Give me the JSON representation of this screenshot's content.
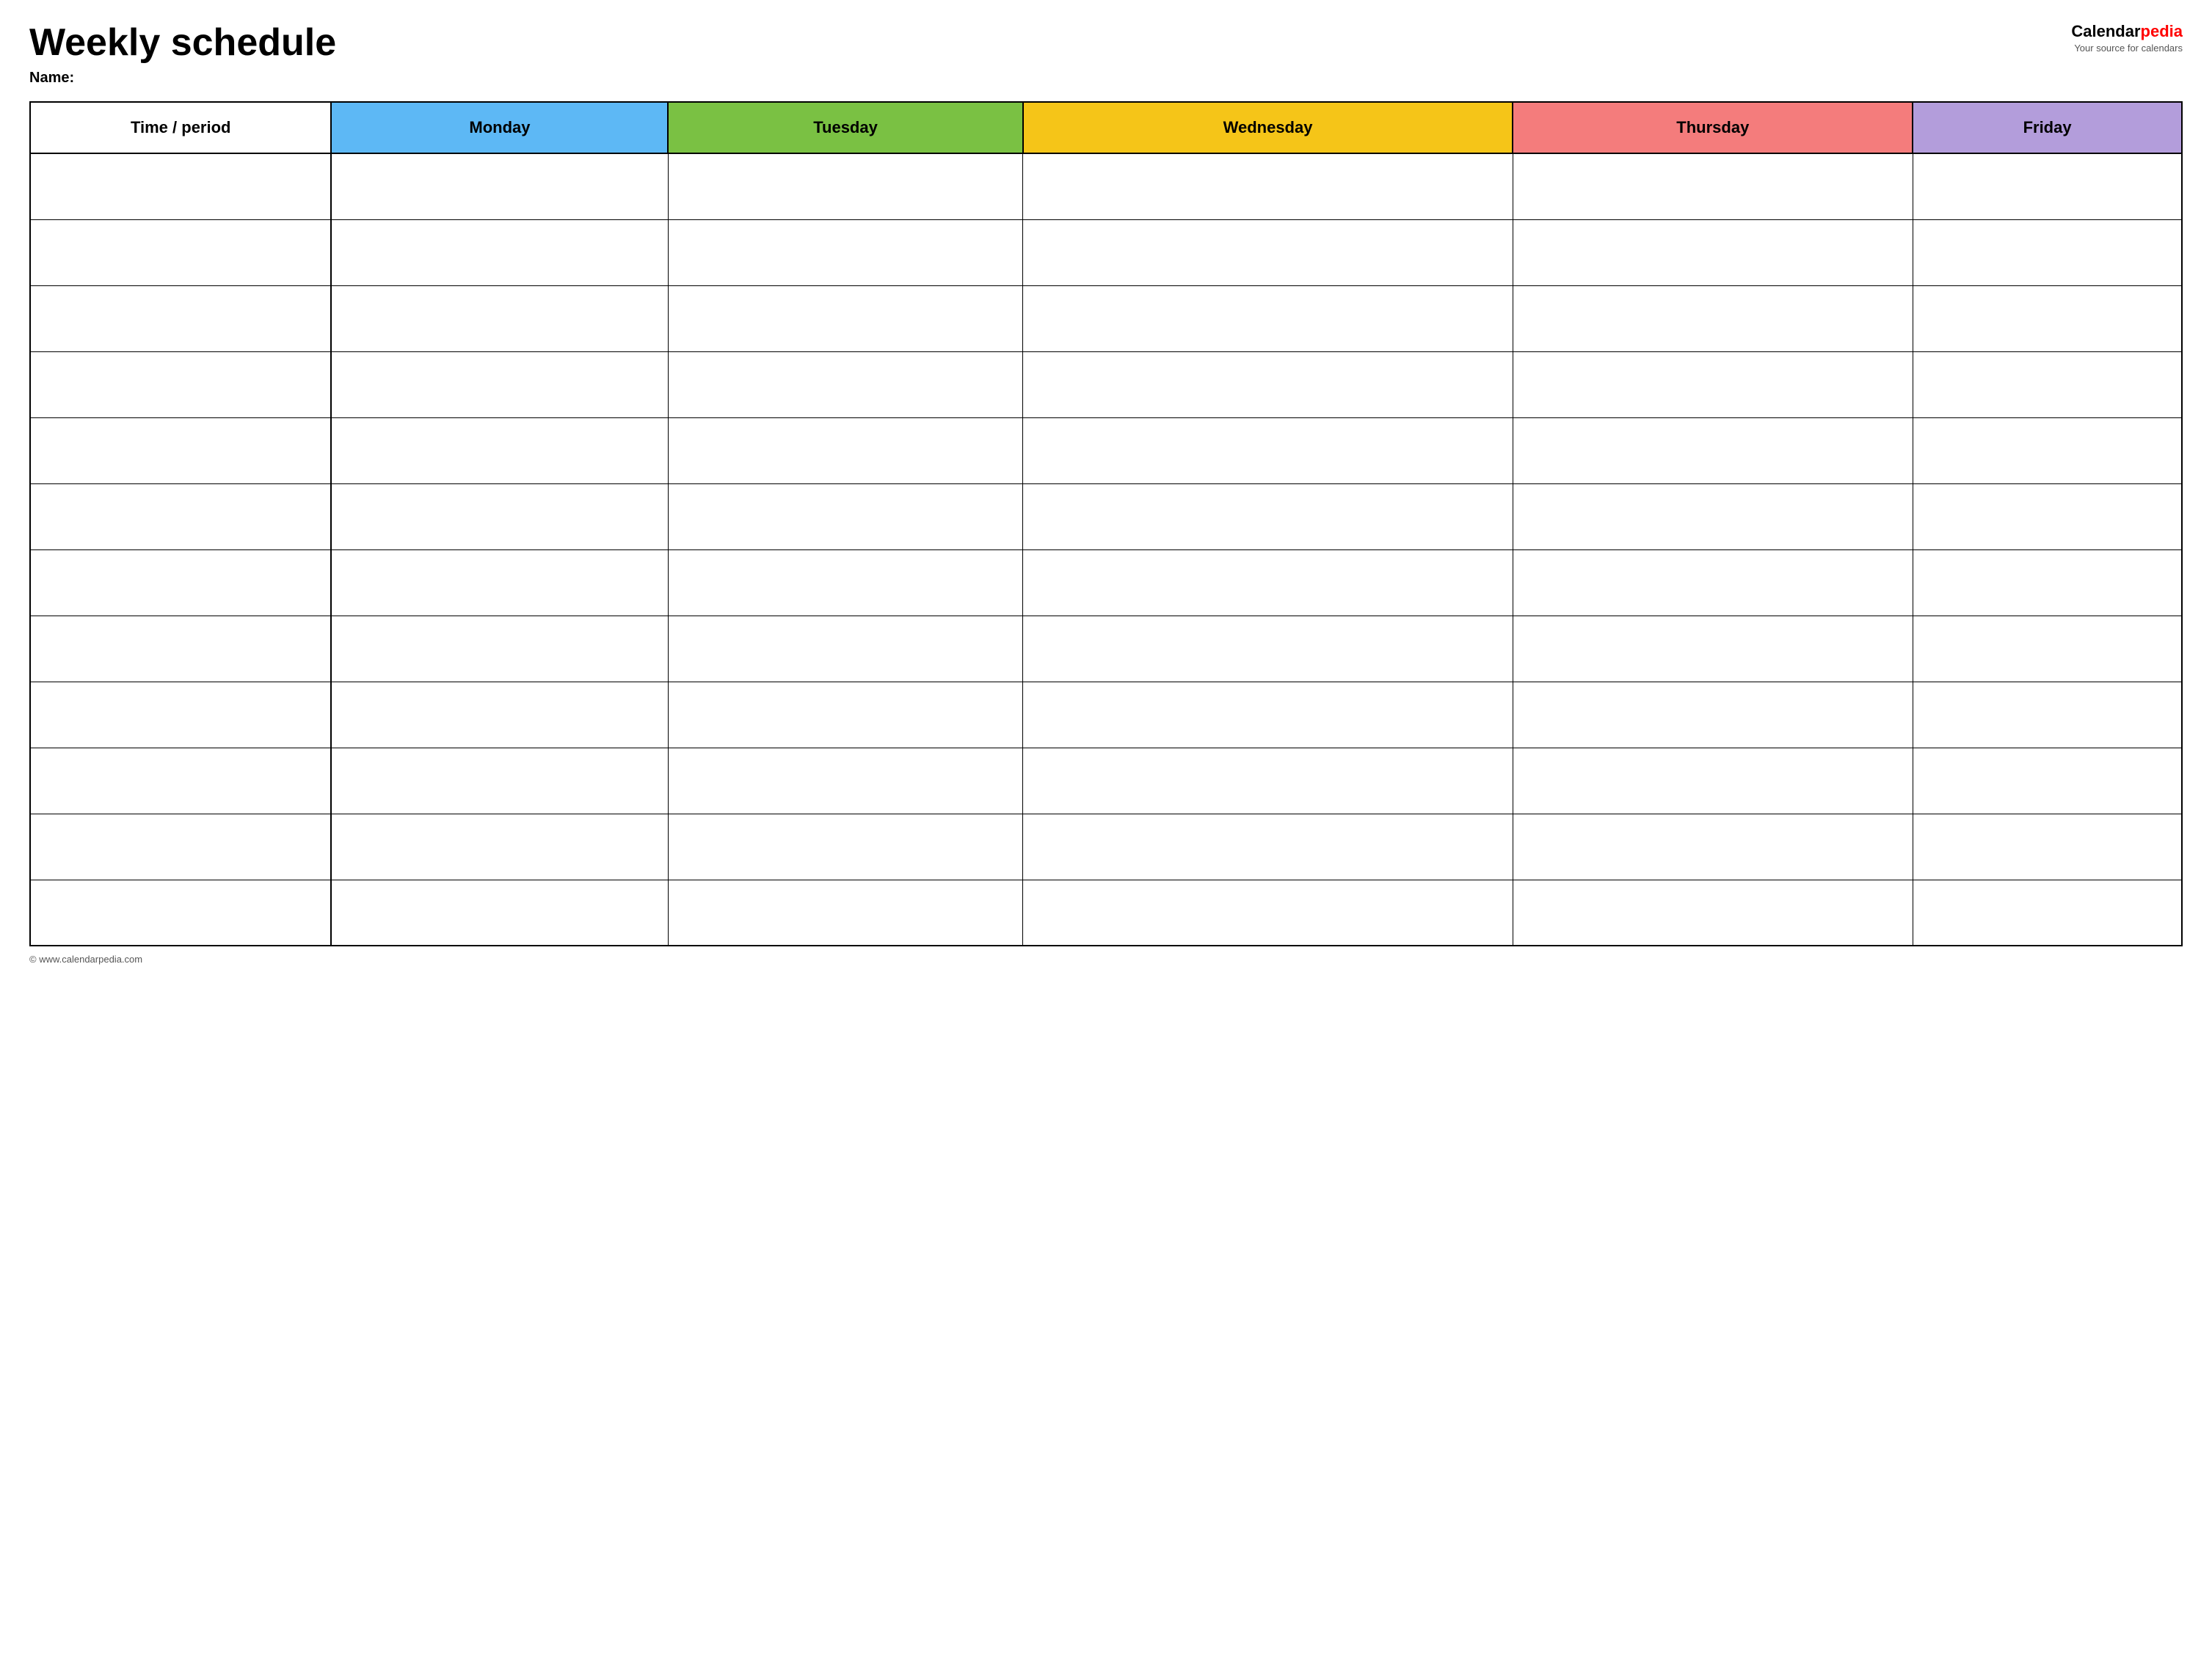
{
  "header": {
    "title": "Weekly schedule",
    "name_label": "Name:",
    "logo_text": "Calendar",
    "logo_pedia": "pedia",
    "logo_tagline": "Your source for calendars"
  },
  "table": {
    "columns": [
      {
        "key": "time",
        "label": "Time / period",
        "color": "#ffffff"
      },
      {
        "key": "monday",
        "label": "Monday",
        "color": "#5db8f5"
      },
      {
        "key": "tuesday",
        "label": "Tuesday",
        "color": "#7ac143"
      },
      {
        "key": "wednesday",
        "label": "Wednesday",
        "color": "#f5c518"
      },
      {
        "key": "thursday",
        "label": "Thursday",
        "color": "#f47c7c"
      },
      {
        "key": "friday",
        "label": "Friday",
        "color": "#b39ddb"
      }
    ],
    "row_count": 12
  },
  "footer": {
    "url": "© www.calendarpedia.com"
  }
}
